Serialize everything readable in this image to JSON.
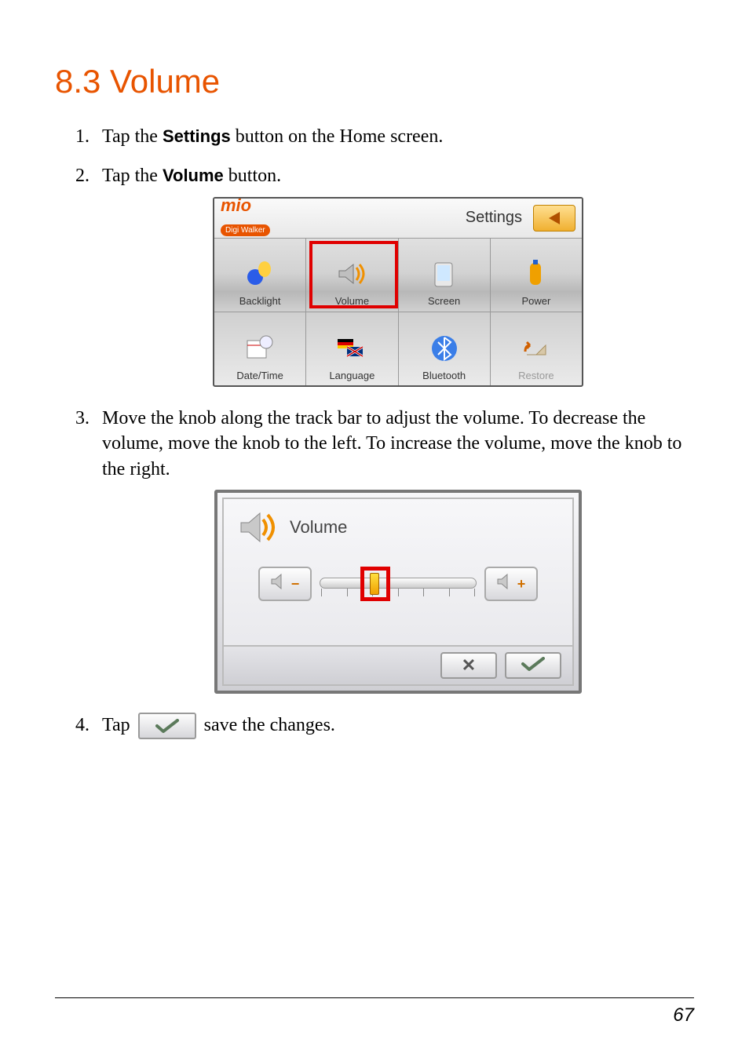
{
  "heading": "8.3  Volume",
  "steps": {
    "s1": {
      "lead": "Tap the ",
      "bold": "Settings",
      "tail": " button on the Home screen."
    },
    "s2": {
      "lead": "Tap the ",
      "bold": "Volume",
      "tail": " button."
    },
    "s3": "Move the knob along the track bar to adjust the volume. To decrease the volume, move the knob to the left. To increase the volume, move the knob to the right.",
    "s4": {
      "lead": "Tap ",
      "tail": " save the changes."
    }
  },
  "settings_shot": {
    "brand": "mio",
    "brand_sub": "Digi Walker",
    "title": "Settings",
    "items_row1": [
      "Backlight",
      "Volume",
      "Screen",
      "Power"
    ],
    "items_row2": [
      "Date/Time",
      "Language",
      "Bluetooth",
      "Restore"
    ],
    "highlighted": "Volume"
  },
  "volume_shot": {
    "title": "Volume",
    "minus": "−",
    "plus": "+",
    "cancel": "✕",
    "confirm": "✔"
  },
  "page_number": "67"
}
